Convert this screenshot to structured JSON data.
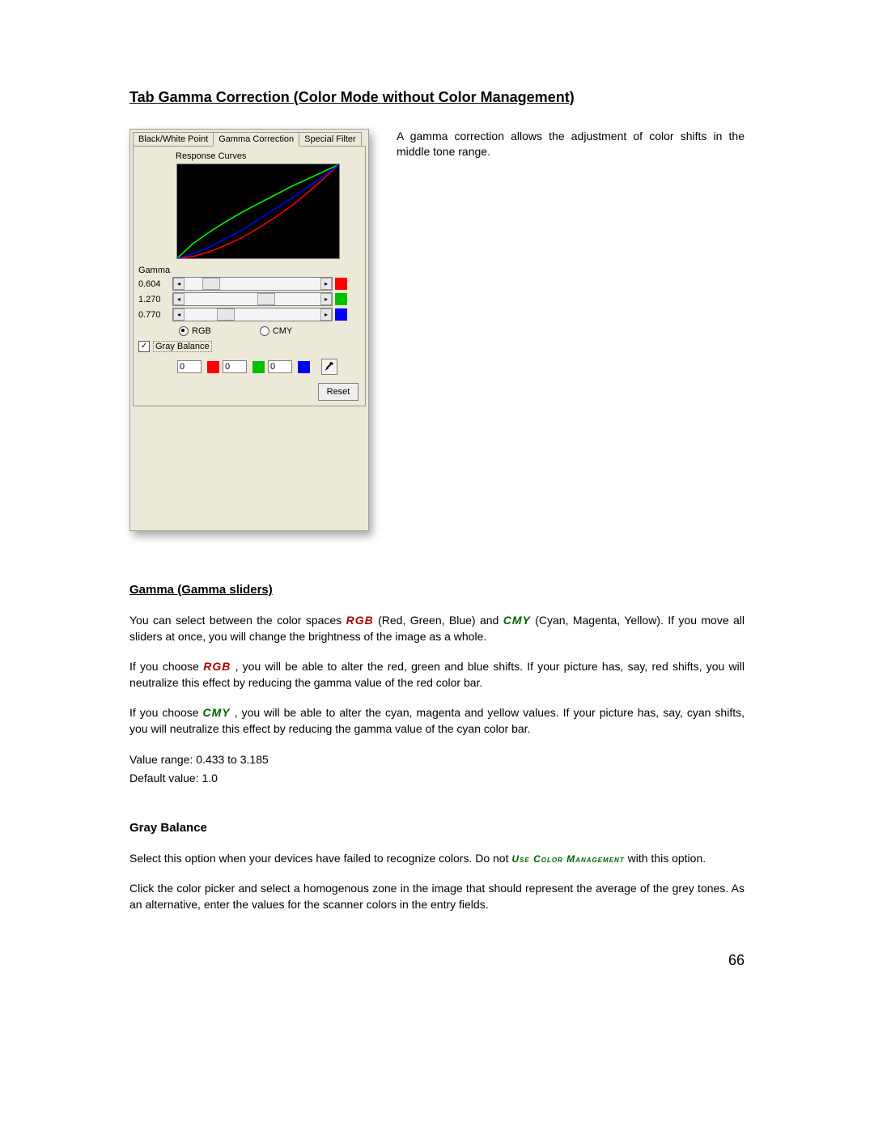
{
  "doc": {
    "title": "Tab Gamma Correction (Color Mode without Color Management)",
    "intro": "A gamma correction allows the adjustment of color shifts in the middle tone range.",
    "page_number": "66",
    "section1": {
      "heading": "Gamma (Gamma sliders)",
      "p1_a": "You can select between the color spaces ",
      "rgb": "RGB",
      "p1_b": " (Red, Green, Blue) and ",
      "cmy": "CMY",
      "p1_c": " (Cyan, Magenta, Yellow). If you move all sliders at once, you will change the brightness of the image as a whole.",
      "p2_a": "If you choose ",
      "p2_b": ", you will be able to alter the red, green and blue shifts. If your picture has, say, red shifts, you will neutralize this effect by reducing the gamma value of the red color bar.",
      "p3_a": "If you choose ",
      "p3_b": ", you will be able to alter the cyan, magenta and yellow values. If your picture has, say, cyan shifts, you will neutralize this effect by reducing the gamma value of the cyan color bar.",
      "range": "Value range: 0.433 to 3.185",
      "default": "Default value: 1.0"
    },
    "section2": {
      "heading": "Gray Balance",
      "p1_a": "Select this option when your devices have failed to recognize colors. Do not ",
      "ucm": "Use Color Management",
      "p1_b": " with this option.",
      "p2": "Click the color picker and select a homogenous zone in the image that should represent the average of the grey tones. As an alternative, enter the values for the scanner colors in the entry fields."
    }
  },
  "panel": {
    "tabs": [
      "Black/White Point",
      "Gamma Correction",
      "Special Filter"
    ],
    "active_tab": 1,
    "response_label": "Response Curves",
    "gamma_label": "Gamma",
    "sliders": [
      {
        "value": "0.604",
        "thumb_pos": 22,
        "color": "#ff0000"
      },
      {
        "value": "1.270",
        "thumb_pos": 90,
        "color": "#00c000"
      },
      {
        "value": "0.770",
        "thumb_pos": 40,
        "color": "#0000ff"
      }
    ],
    "radios": {
      "rgb": "RGB",
      "cmy": "CMY",
      "selected": "RGB"
    },
    "gray_balance": {
      "label": "Gray Balance",
      "checked": true,
      "fields": [
        {
          "value": "0",
          "color": "#ff0000"
        },
        {
          "value": "0",
          "color": "#00c000"
        },
        {
          "value": "0",
          "color": "#0000ff"
        }
      ]
    },
    "reset_label": "Reset"
  },
  "chart_data": {
    "type": "line",
    "title": "Response Curves",
    "xlabel": "",
    "ylabel": "",
    "xlim": [
      0,
      1
    ],
    "ylim": [
      0,
      1
    ],
    "series": [
      {
        "name": "Red (gamma 0.604)",
        "color": "#ff0000",
        "x": [
          0,
          0.1,
          0.2,
          0.3,
          0.4,
          0.5,
          0.6,
          0.7,
          0.8,
          0.9,
          1.0
        ],
        "values": [
          0.0,
          0.02,
          0.07,
          0.14,
          0.22,
          0.32,
          0.43,
          0.55,
          0.69,
          0.84,
          1.0
        ]
      },
      {
        "name": "Green (gamma 1.270)",
        "color": "#00ff00",
        "x": [
          0,
          0.1,
          0.2,
          0.3,
          0.4,
          0.5,
          0.6,
          0.7,
          0.8,
          0.9,
          1.0
        ],
        "values": [
          0.0,
          0.16,
          0.28,
          0.39,
          0.49,
          0.58,
          0.67,
          0.76,
          0.84,
          0.92,
          1.0
        ]
      },
      {
        "name": "Blue (gamma 0.770)",
        "color": "#0000ff",
        "x": [
          0,
          0.1,
          0.2,
          0.3,
          0.4,
          0.5,
          0.6,
          0.7,
          0.8,
          0.9,
          1.0
        ],
        "values": [
          0.0,
          0.05,
          0.12,
          0.21,
          0.3,
          0.41,
          0.52,
          0.63,
          0.75,
          0.87,
          1.0
        ]
      }
    ]
  }
}
